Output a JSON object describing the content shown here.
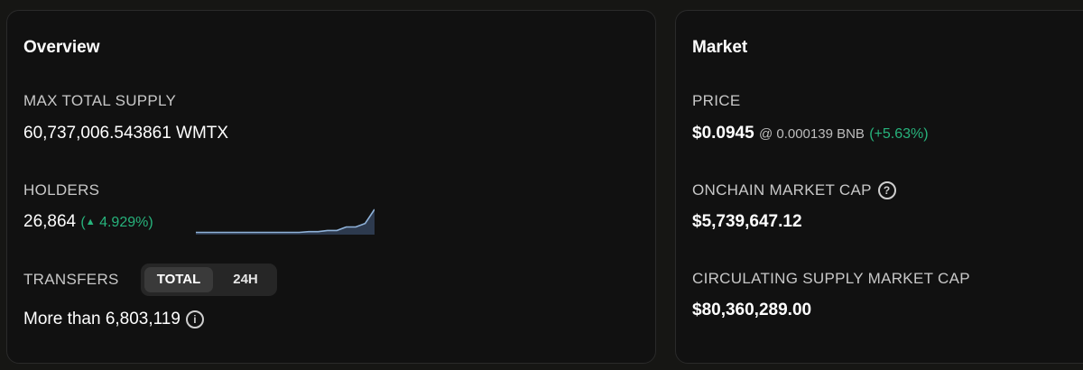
{
  "overview": {
    "title": "Overview",
    "max_supply_label": "MAX TOTAL SUPPLY",
    "max_supply_value": "60,737,006.543861 WMTX",
    "holders_label": "HOLDERS",
    "holders_value": "26,864",
    "holders_change": "4.929%",
    "holders_trend": [
      0.02,
      0.02,
      0.02,
      0.02,
      0.02,
      0.02,
      0.02,
      0.02,
      0.02,
      0.02,
      0.02,
      0.02,
      0.05,
      0.05,
      0.1,
      0.1,
      0.25,
      0.25,
      0.4,
      1.0
    ],
    "transfers_label": "TRANSFERS",
    "transfers_tabs": [
      "TOTAL",
      "24H"
    ],
    "transfers_value": "More than 6,803,119"
  },
  "market": {
    "title": "Market",
    "price_label": "PRICE",
    "price_value": "$0.0945",
    "price_bnb": "@ 0.000139 BNB",
    "price_change": "(+5.63%)",
    "onchain_cap_label": "ONCHAIN MARKET CAP",
    "onchain_cap_value": "$5,739,647.12",
    "circ_cap_label": "CIRCULATING SUPPLY MARKET CAP",
    "circ_cap_value": "$80,360,289.00"
  },
  "colors": {
    "positive": "#27b37c",
    "card_bg": "#111111",
    "page_bg": "#161614"
  },
  "icons": {
    "change_up": "caret-up-icon",
    "info": "info-icon",
    "help": "question-icon"
  }
}
